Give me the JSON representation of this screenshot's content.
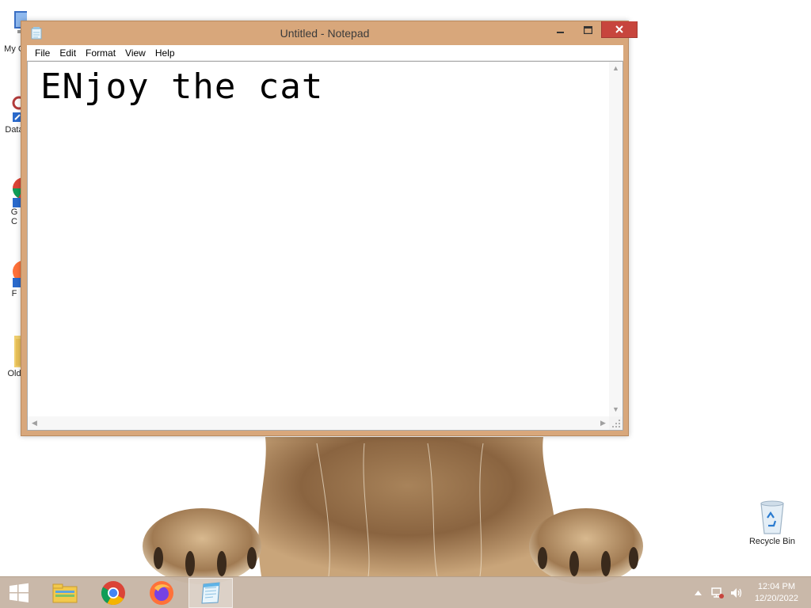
{
  "window": {
    "title": "Untitled - Notepad",
    "menu": [
      "File",
      "Edit",
      "Format",
      "View",
      "Help"
    ],
    "content": "ENjoy the cat"
  },
  "desktop": {
    "icons": [
      {
        "label": "My C",
        "icon": "computer-icon"
      },
      {
        "label": "Data",
        "icon": "database-shortcut-icon"
      },
      {
        "label": "G",
        "label2": "C",
        "icon": "chrome-shortcut-icon"
      },
      {
        "label": "F",
        "icon": "firefox-shortcut-icon"
      },
      {
        "label": "Old",
        "icon": "folder-icon"
      }
    ],
    "recycle_bin_label": "Recycle Bin"
  },
  "taskbar": {
    "items": [
      "start-icon",
      "file-explorer-icon",
      "chrome-icon",
      "firefox-icon",
      "notepad-icon"
    ],
    "active_item": "notepad",
    "tray_icons": [
      "show-hidden-icons-icon",
      "network-icon",
      "volume-icon"
    ],
    "time": "12:04 PM",
    "date": "12/20/2022"
  },
  "colors": {
    "window_frame": "#d8a77b",
    "close_button": "#c7453d",
    "taskbar": "#c4b2a2"
  }
}
